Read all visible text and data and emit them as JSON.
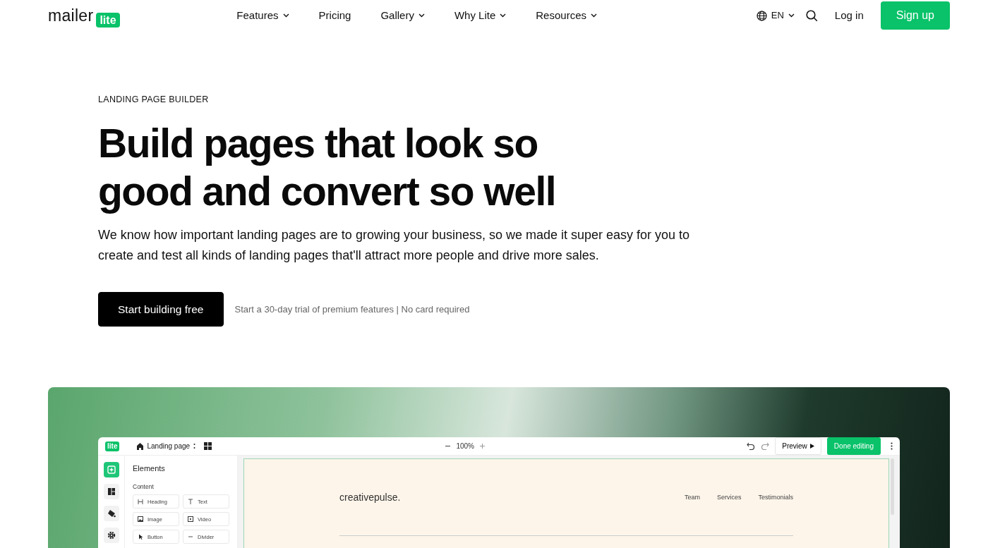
{
  "header": {
    "logo": {
      "word": "mailer",
      "badge": "lite"
    },
    "nav": [
      {
        "label": "Features",
        "dropdown": true
      },
      {
        "label": "Pricing",
        "dropdown": false
      },
      {
        "label": "Gallery",
        "dropdown": true
      },
      {
        "label": "Why Lite",
        "dropdown": true
      },
      {
        "label": "Resources",
        "dropdown": true
      }
    ],
    "language": "EN",
    "login": "Log in",
    "signup": "Sign up"
  },
  "hero": {
    "eyebrow": "LANDING PAGE BUILDER",
    "title_lines": [
      "Build pages that look so",
      "good and convert so well"
    ],
    "description": "We know how important landing pages are to growing your business, so we made it super easy for you to create and test all kinds of landing pages that'll attract more people and drive more sales.",
    "cta": "Start building free",
    "note": "Start a 30-day trial of premium features | No card required"
  },
  "editor": {
    "logo": "lite",
    "page_name": "Landing page",
    "zoom": "100%",
    "preview": "Preview",
    "done": "Done editing",
    "rail": [
      {
        "kind": "plus",
        "selected": true
      },
      {
        "kind": "layout",
        "selected": false
      },
      {
        "kind": "paint",
        "selected": false
      },
      {
        "kind": "gear",
        "selected": false
      }
    ],
    "panel_title": "Elements",
    "section": "Content",
    "elements": [
      {
        "kind": "heading",
        "label": "Heading"
      },
      {
        "kind": "text",
        "label": "Text"
      },
      {
        "kind": "image",
        "label": "Image"
      },
      {
        "kind": "video",
        "label": "Video"
      },
      {
        "kind": "button",
        "label": "Button"
      },
      {
        "kind": "divider",
        "label": "Divider"
      }
    ],
    "canvas": {
      "brand": "creativepulse.",
      "links": [
        "Team",
        "Services",
        "Testimonials"
      ]
    }
  }
}
